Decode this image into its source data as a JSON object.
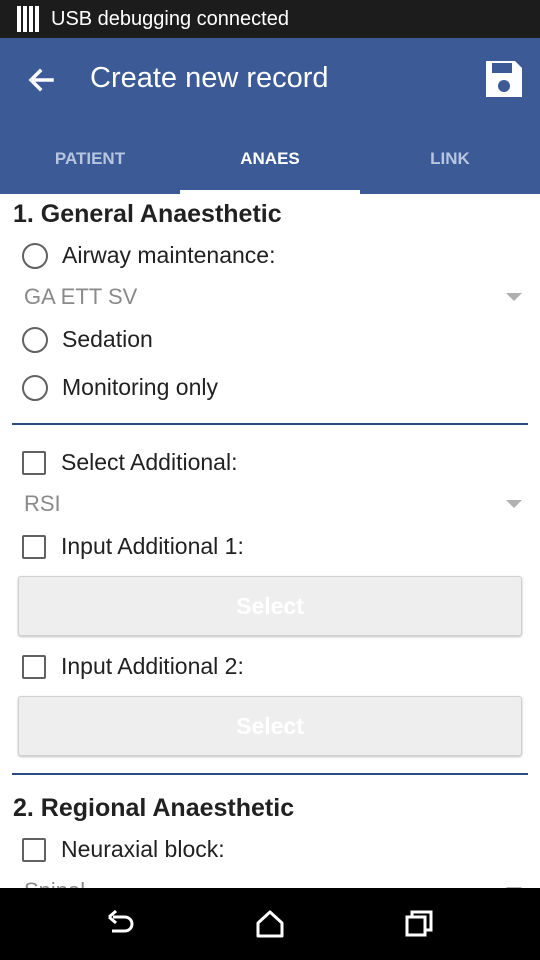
{
  "status_bar": {
    "text": "USB debugging connected"
  },
  "app_bar": {
    "title": "Create new record"
  },
  "tabs": [
    {
      "label": "PATIENT",
      "active": false
    },
    {
      "label": "ANAES",
      "active": true
    },
    {
      "label": "LINK",
      "active": false
    }
  ],
  "section1": {
    "title": "1. General Anaesthetic",
    "options": [
      {
        "label": "Airway maintenance:",
        "selected": false
      },
      {
        "label": "Sedation",
        "selected": false
      },
      {
        "label": "Monitoring only",
        "selected": false
      }
    ],
    "airway_dropdown": "GA ETT SV",
    "select_additional": {
      "label": "Select Additional:",
      "checked": false,
      "value": "RSI"
    },
    "input_additional_1": {
      "label": "Input Additional 1:",
      "checked": false,
      "button": "Select"
    },
    "input_additional_2": {
      "label": "Input Additional 2:",
      "checked": false,
      "button": "Select"
    }
  },
  "section2": {
    "title": "2. Regional Anaesthetic",
    "neuraxial": {
      "label": "Neuraxial block:",
      "checked": false,
      "value": "Spinal"
    }
  },
  "colors": {
    "primary": "#3b5a96",
    "divider": "#2a4a80"
  }
}
